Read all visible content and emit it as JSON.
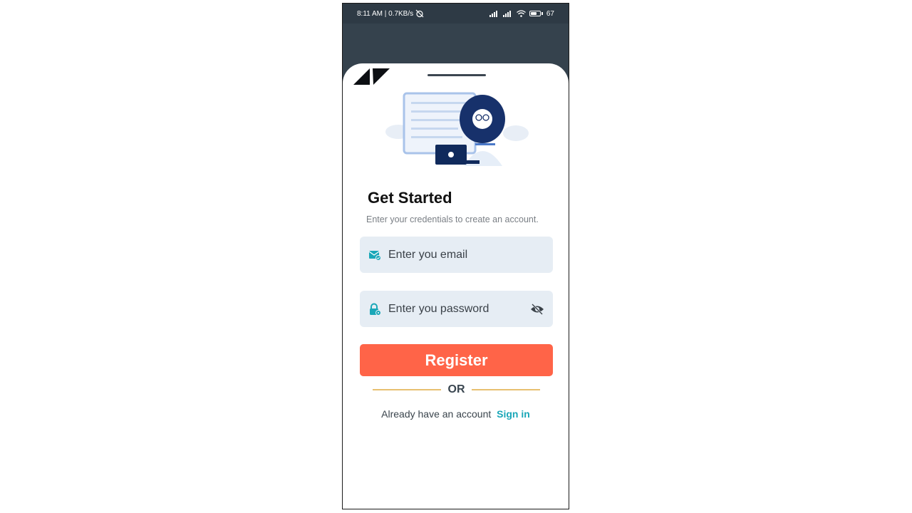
{
  "status_bar": {
    "time_speed": "8:11 AM | 0.7KB/s",
    "battery": "67",
    "battery_level": 0.67
  },
  "auth": {
    "title": "Get Started",
    "subtitle": "Enter your credentials to create an account.",
    "email_placeholder": "Enter you email",
    "password_placeholder": "Enter you password",
    "register_label": "Register",
    "or_label": "OR",
    "already_label": "Already have an account",
    "signin_label": "Sign in"
  },
  "colors": {
    "accent": "#ff6448",
    "link": "#1aa7b8",
    "field_bg": "#e6edf4",
    "header_bg": "#35424d",
    "divider": "#e8c070"
  },
  "icons": {
    "email": "email-check-icon",
    "password": "lock-icon",
    "toggle": "eye-off-icon",
    "alarm": "alarm-off-icon",
    "signal": "signal-icon",
    "wifi": "wifi-icon",
    "battery": "battery-icon"
  }
}
